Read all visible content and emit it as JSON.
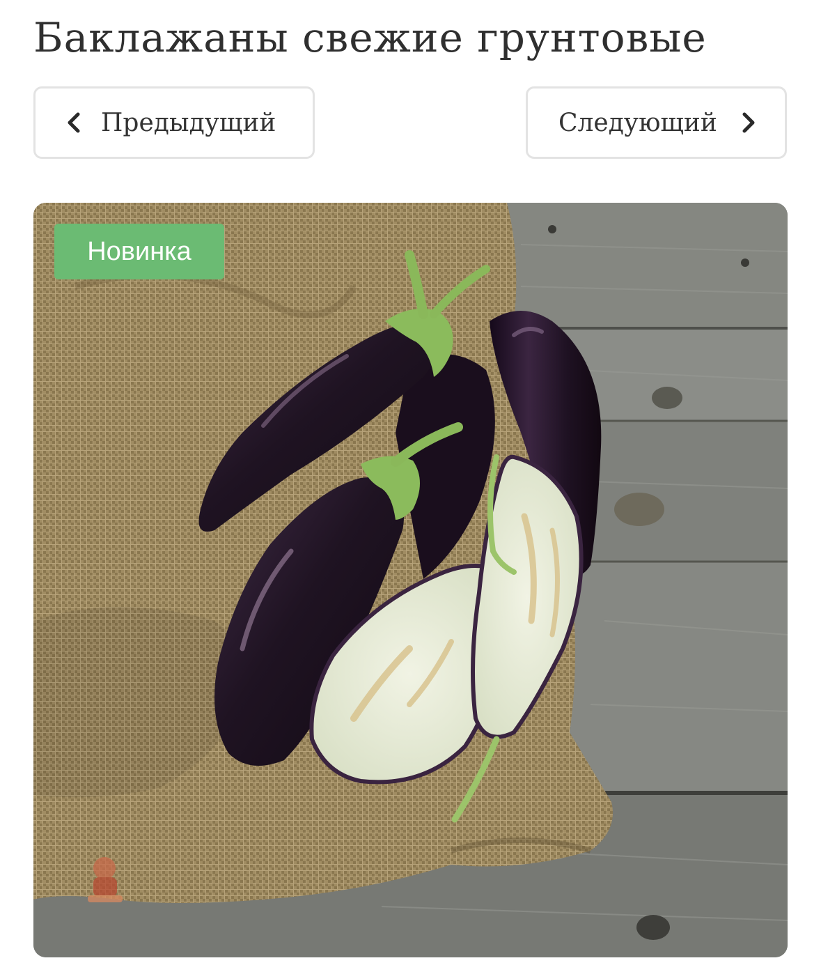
{
  "product": {
    "title": "Баклажаны свежие грунтовые",
    "badge": "Новинка",
    "image_subject": "eggplants"
  },
  "navigation": {
    "prev_label": "Предыдущий",
    "next_label": "Следующий",
    "prev_icon": "chevron-left-icon",
    "next_icon": "chevron-right-icon"
  },
  "colors": {
    "title": "#2f2f2f",
    "badge_bg": "#6bbb73",
    "badge_text": "#ffffff",
    "button_border": "#e3e3e3"
  }
}
